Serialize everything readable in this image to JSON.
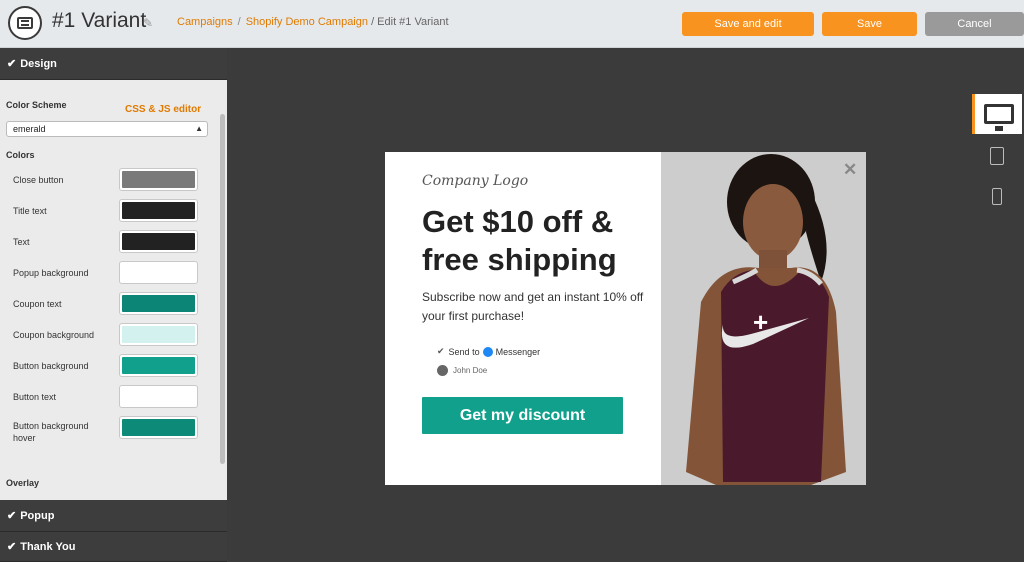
{
  "header": {
    "title": "#1 Variant",
    "breadcrumb": [
      "Campaigns",
      "Shopify Demo Campaign",
      "/ Edit #1 Variant"
    ],
    "save_and_edit": "Save and edit",
    "save": "Save",
    "cancel": "Cancel"
  },
  "sidebar": {
    "sections": [
      "Design",
      "Popup",
      "Thank You"
    ],
    "color_scheme_label": "Color Scheme",
    "css_js_link": "CSS & JS editor",
    "color_scheme_value": "emerald",
    "colors_label": "Colors",
    "overlay_label": "Overlay",
    "colors": [
      {
        "label": "Close button",
        "color": "#7a7a7a"
      },
      {
        "label": "Title text",
        "color": "#222222"
      },
      {
        "label": "Text",
        "color": "#222222"
      },
      {
        "label": "Popup background",
        "color": "#ffffff"
      },
      {
        "label": "Coupon text",
        "color": "#0d8576"
      },
      {
        "label": "Coupon background",
        "color": "#d3f1ee"
      },
      {
        "label": "Button background",
        "color": "#11a08c"
      },
      {
        "label": "Button text",
        "color": "#ffffff"
      },
      {
        "label": "Button background hover",
        "color": "#0d8a78"
      }
    ]
  },
  "popup": {
    "logo": "Company Logo",
    "headline": "Get $10 off & free shipping",
    "subtext": "Subscribe now and get an instant 10% off your first purchase!",
    "send_to": "Send to",
    "messenger": "Messenger",
    "user": "John Doe",
    "cta": "Get my discount"
  },
  "devices": [
    "desktop-icon",
    "tablet-icon",
    "mobile-icon"
  ],
  "colors": {
    "accent": "#f7931e",
    "cta": "#11a08c",
    "link": "#e07b00"
  }
}
